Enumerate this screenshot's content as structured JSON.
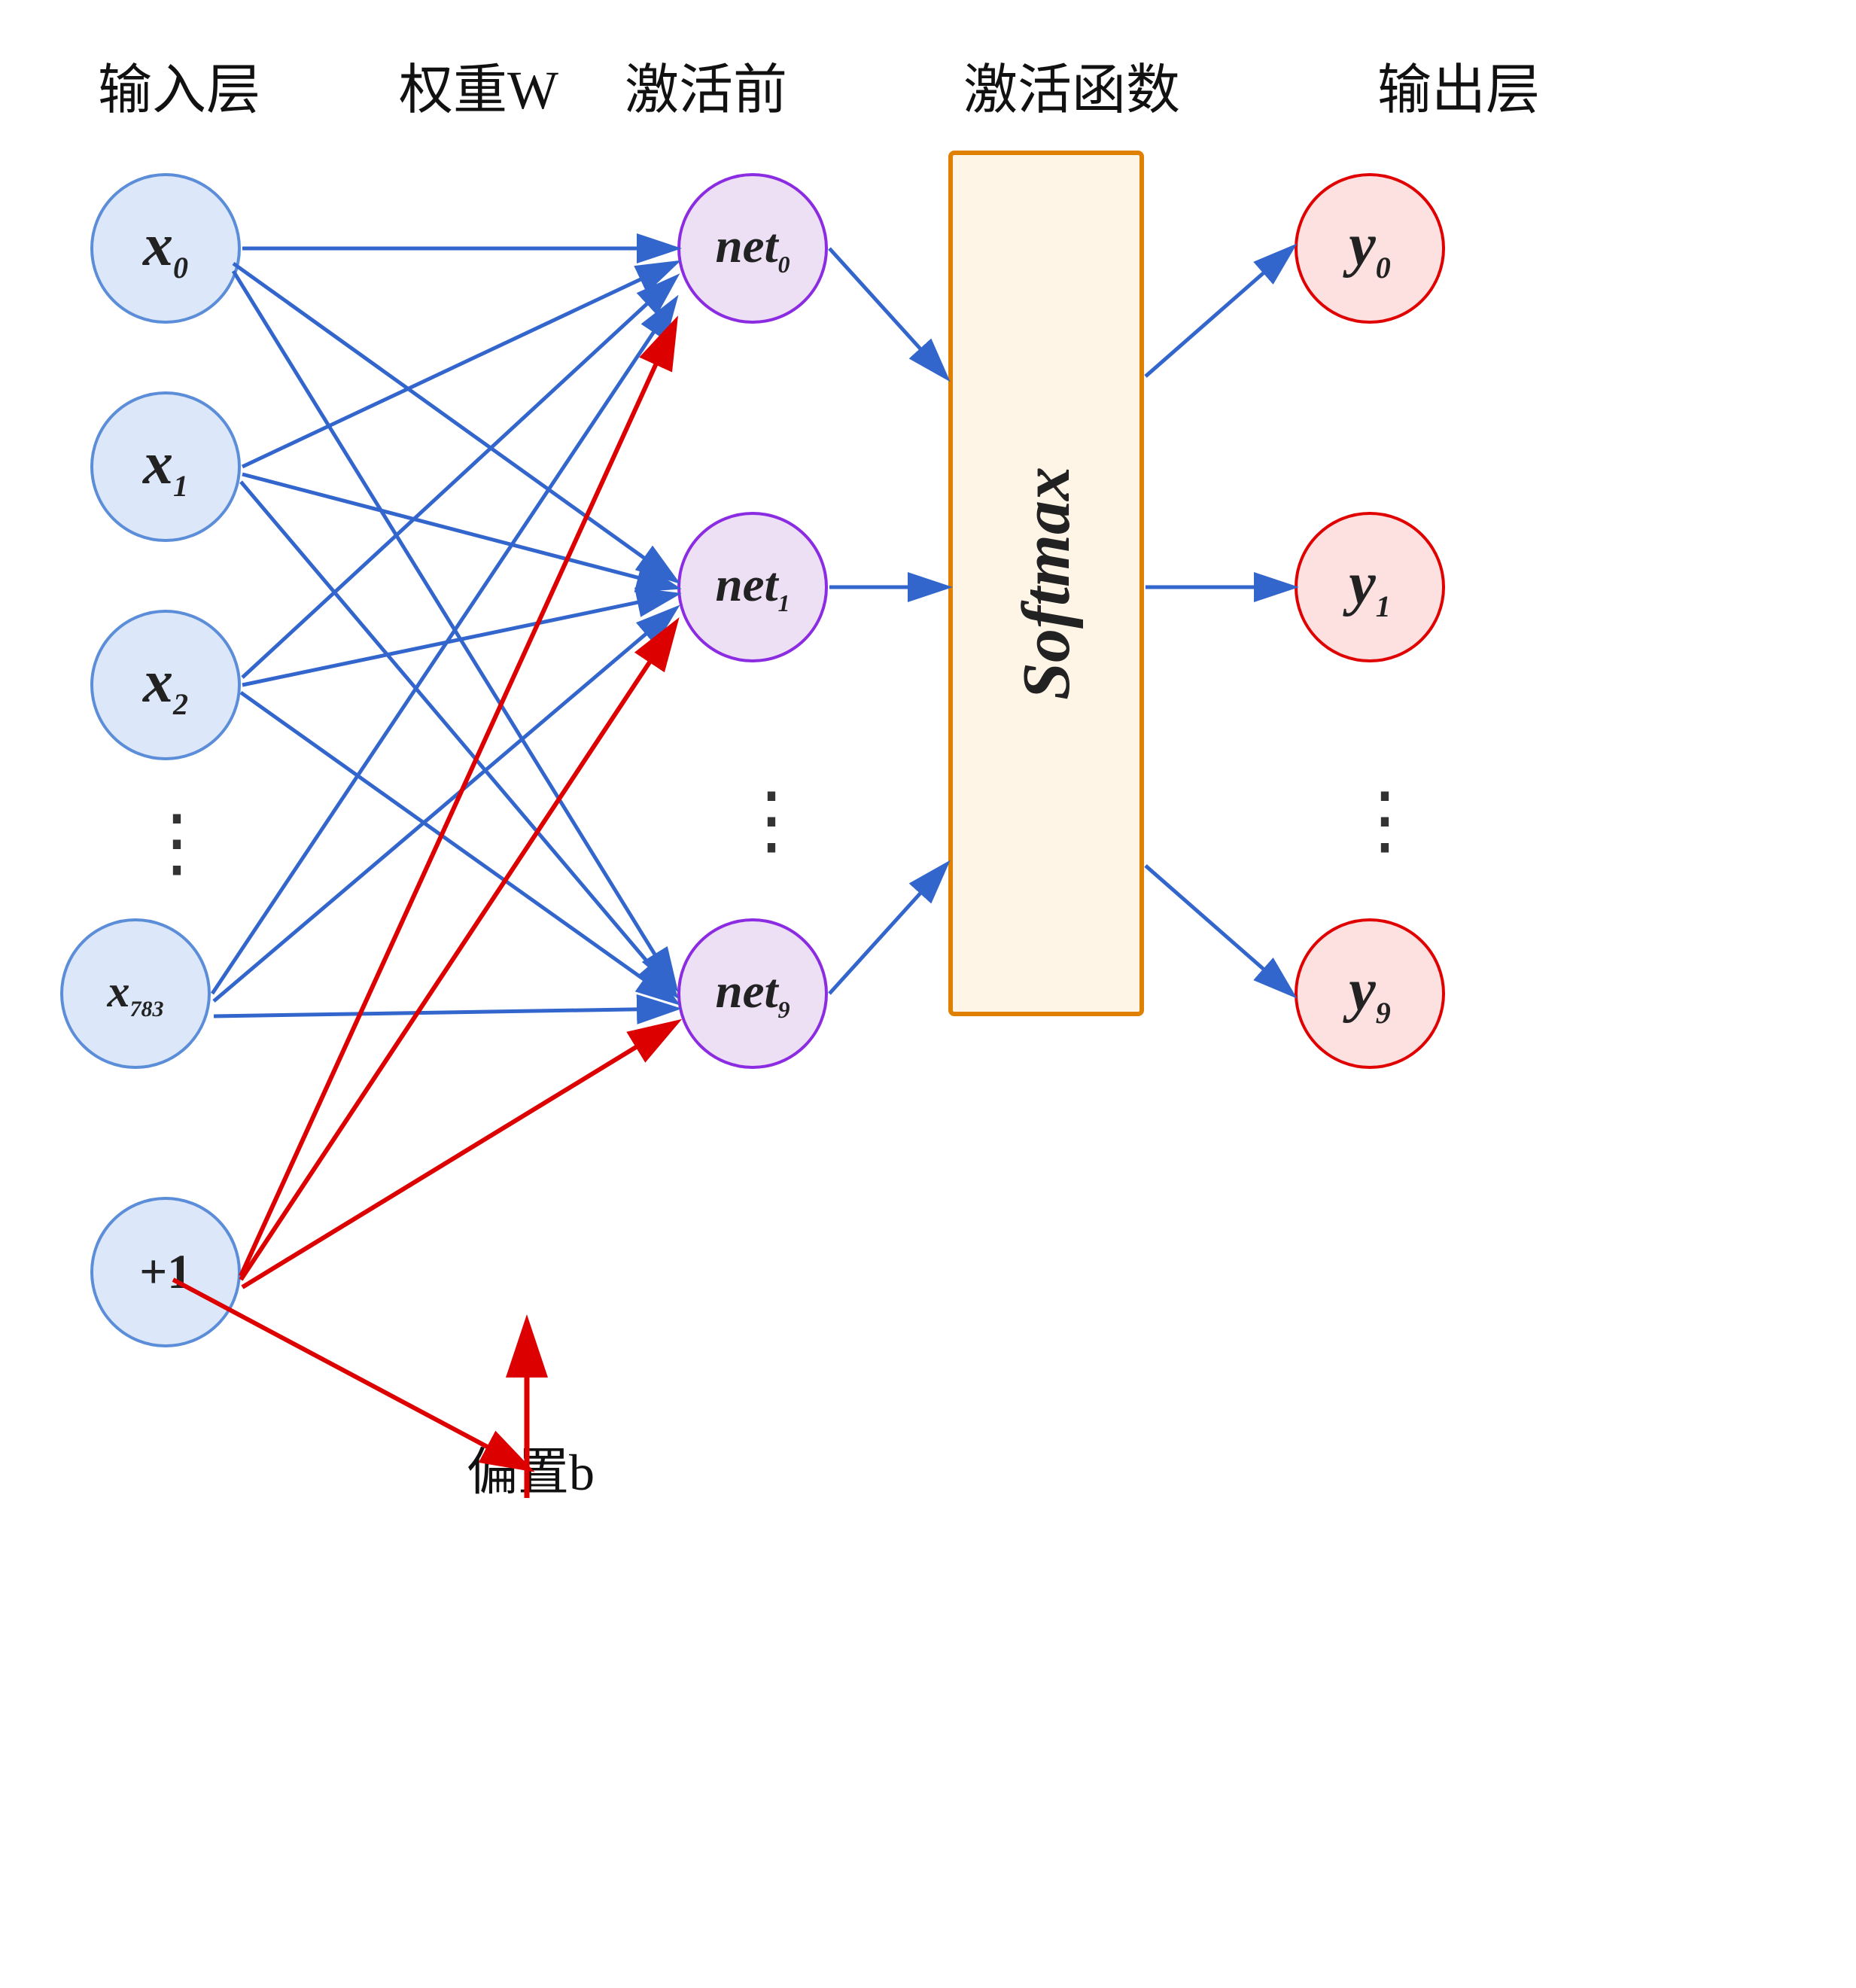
{
  "headers": {
    "input_layer": "输入层",
    "weight_w": "权重W",
    "pre_activation": "激活前",
    "activation_fn": "激活函数",
    "output_layer": "输出层"
  },
  "input_nodes": [
    {
      "id": "x0",
      "label": "x",
      "sub": "0"
    },
    {
      "id": "x1",
      "label": "x",
      "sub": "1"
    },
    {
      "id": "x2",
      "label": "x",
      "sub": "2"
    },
    {
      "id": "dots",
      "label": "…",
      "sub": ""
    },
    {
      "id": "x783",
      "label": "x",
      "sub": "783"
    },
    {
      "id": "bias",
      "label": "+1",
      "sub": ""
    }
  ],
  "hidden_nodes": [
    {
      "id": "net0",
      "label": "net",
      "sub": "0"
    },
    {
      "id": "net1",
      "label": "net",
      "sub": "1"
    },
    {
      "id": "dots",
      "label": "…",
      "sub": ""
    },
    {
      "id": "net9",
      "label": "net",
      "sub": "9"
    }
  ],
  "output_nodes": [
    {
      "id": "y0",
      "label": "y",
      "sub": "0"
    },
    {
      "id": "y1",
      "label": "y",
      "sub": "1"
    },
    {
      "id": "dots",
      "label": "…",
      "sub": ""
    },
    {
      "id": "y9",
      "label": "y",
      "sub": "9"
    }
  ],
  "softmax_label": "Softmax",
  "bias_label": "偏置b",
  "colors": {
    "blue_arrow": "#3366cc",
    "red_arrow": "#dd0000",
    "orange_border": "#e08000"
  }
}
